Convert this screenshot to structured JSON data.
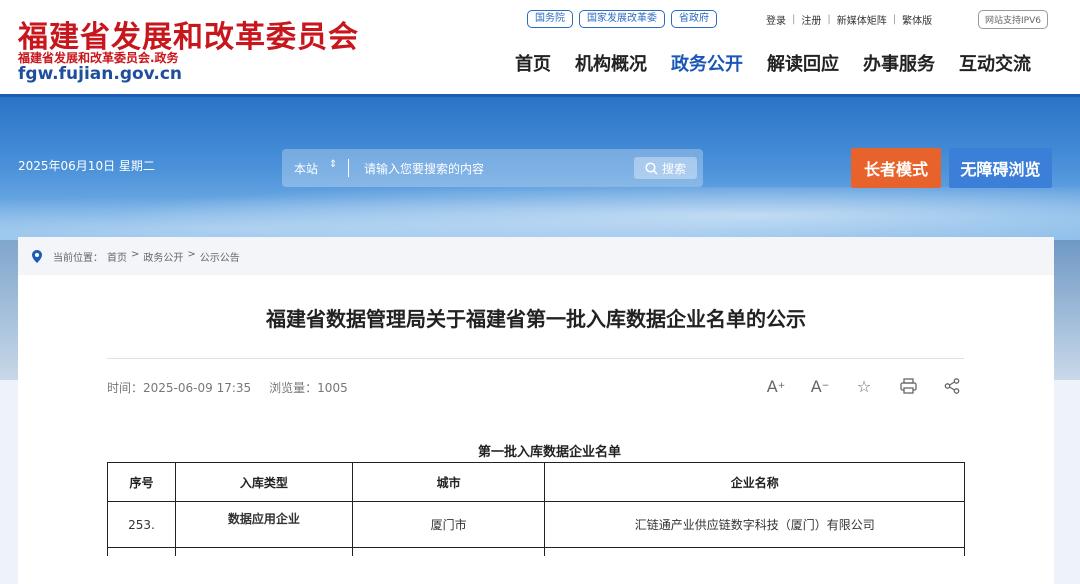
{
  "header": {
    "site_name": "福建省发展和改革委员会",
    "site_sub": "福建省发展和改革委员会.政务",
    "site_url": "fgw.fujian.gov.cn",
    "gov_links": [
      "国务院",
      "国家发展改革委",
      "省政府"
    ],
    "util_links": [
      "登录",
      "注册",
      "新媒体矩阵",
      "繁体版"
    ],
    "ipv6_badge": "网站支持IPV6",
    "nav": [
      "首页",
      "机构概况",
      "政务公开",
      "解读回应",
      "办事服务",
      "互动交流"
    ],
    "nav_active_index": 2
  },
  "banner": {
    "date": "2025年06月10日 星期二",
    "search_scope": "本站",
    "search_placeholder": "请输入您要搜索的内容",
    "search_button": "搜索",
    "elder_mode": "长者模式",
    "accessible": "无障碍浏览"
  },
  "breadcrumb": {
    "label": "当前位置：",
    "items": [
      "首页",
      "政务公开",
      "公示公告"
    ]
  },
  "article": {
    "title": "福建省数据管理局关于福建省第一批入库数据企业名单的公示",
    "time_label": "时间：",
    "time": "2025-06-09 17:35",
    "views_label": "浏览量：",
    "views": "1005",
    "table_caption": "第一批入库数据企业名单",
    "columns": [
      "序号",
      "入库类型",
      "城市",
      "企业名称"
    ],
    "rows": [
      [
        "253.",
        "数据应用企业",
        "厦门市",
        "汇链通产业供应链数字科技（厦门）有限公司"
      ]
    ]
  },
  "colors": {
    "brand_red": "#c8161d",
    "nav_active": "#1a56b8",
    "elder_button": "#e8632c",
    "access_button": "#3c7fd8"
  }
}
